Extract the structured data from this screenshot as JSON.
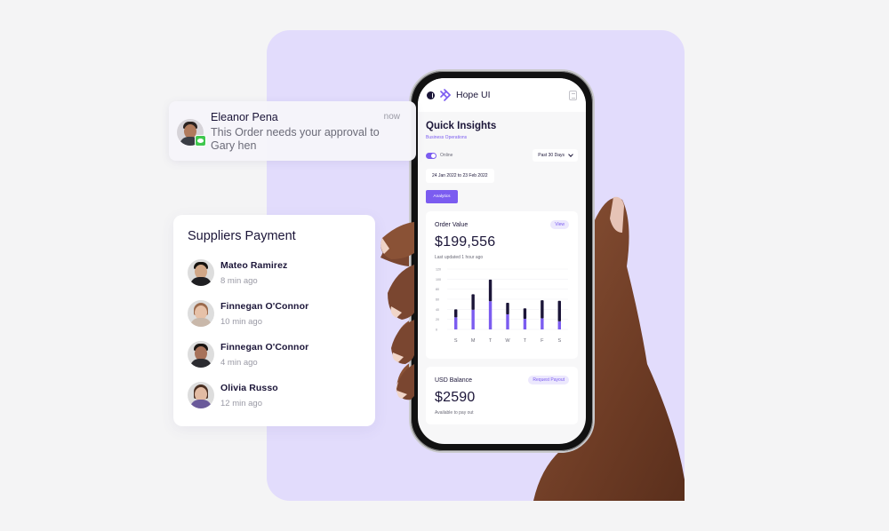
{
  "notification": {
    "sender": "Eleanor Pena",
    "message": "This Order needs your approval to Gary hen",
    "time": "now",
    "app_icon": "messages-icon"
  },
  "suppliers": {
    "title": "Suppliers Payment",
    "items": [
      {
        "name": "Mateo Ramirez",
        "time": "8 min ago"
      },
      {
        "name": "Finnegan O'Connor",
        "time": "10 min ago"
      },
      {
        "name": "Finnegan O'Connor",
        "time": "4 min ago"
      },
      {
        "name": "Olivia Russo",
        "time": "12 min ago"
      }
    ]
  },
  "phone": {
    "brand": "Hope UI",
    "page_title": "Quick Insights",
    "page_subtitle": "Business Operations",
    "status_toggle_label": "Online",
    "status_toggle_on": true,
    "period_select": "Past 30 Days",
    "date_range": "24 Jan 2022 to 23 Feb 2022",
    "analytics_button": "Analytics",
    "order_card": {
      "label": "Order Value",
      "action": "View",
      "value": "$199,556",
      "note": "Last updated 1 hour ago"
    },
    "balance_card": {
      "label": "USD Balance",
      "action": "Request Payout",
      "value": "$2590",
      "note": "Available to pay out"
    }
  },
  "colors": {
    "accent": "#7b5cf0",
    "dark": "#1b1538",
    "panel": "#e2dcfc"
  },
  "chart_data": {
    "type": "bar",
    "stacked": true,
    "categories": [
      "S",
      "M",
      "T",
      "W",
      "T",
      "F",
      "S"
    ],
    "series": [
      {
        "name": "lower",
        "color": "#7b5cf0",
        "values": [
          24,
          39,
          56,
          30,
          21,
          22,
          16
        ]
      },
      {
        "name": "upper",
        "color": "#1b1538",
        "values": [
          16,
          31,
          43,
          23,
          21,
          36,
          41
        ]
      }
    ],
    "yticks": [
      "0",
      "20",
      "40",
      "60",
      "80",
      "100",
      "120"
    ],
    "ylim": [
      0,
      120
    ],
    "grid": true,
    "title": "",
    "xlabel": "",
    "ylabel": ""
  }
}
